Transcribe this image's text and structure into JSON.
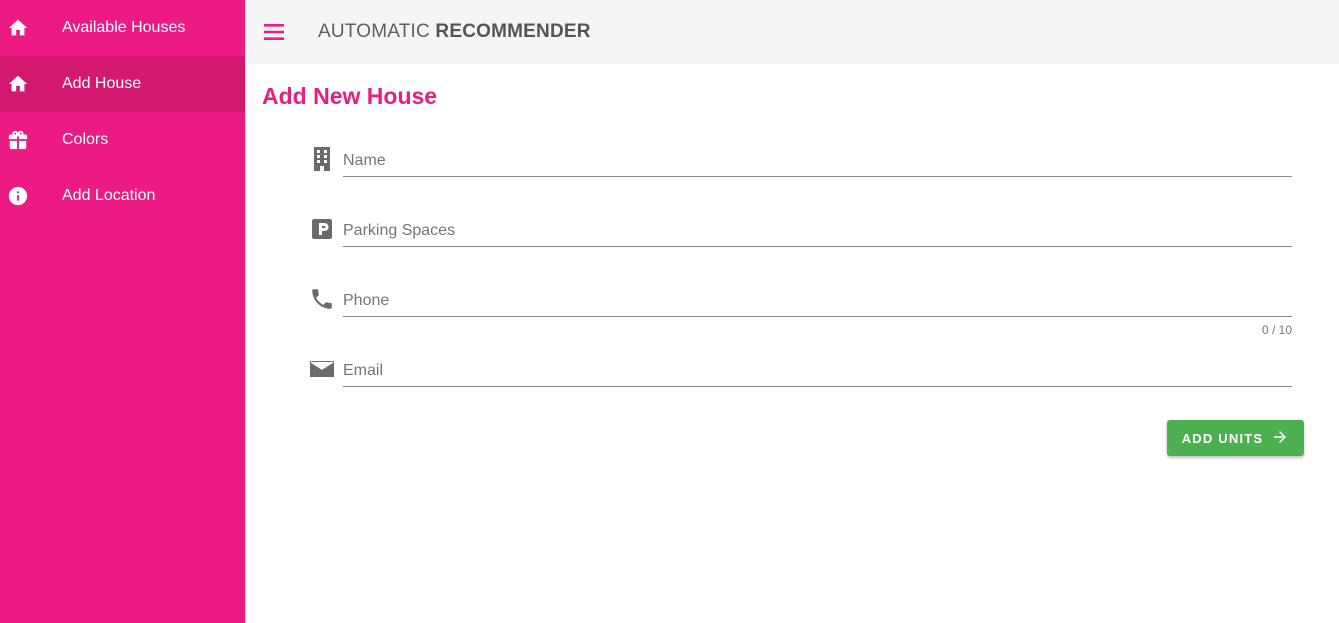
{
  "sidebar": {
    "items": [
      {
        "label": "Available Houses",
        "icon": "home-icon"
      },
      {
        "label": "Add House",
        "icon": "home-icon",
        "active": true
      },
      {
        "label": "Colors",
        "icon": "gift-icon"
      },
      {
        "label": "Add Location",
        "icon": "info-icon"
      }
    ],
    "background": "#ec1a83",
    "active_background": "#d3186f"
  },
  "header": {
    "title_prefix": "AUTOMATIC",
    "title_bold": "RECOMMENDER",
    "menu_icon": "menu-icon"
  },
  "main": {
    "page_title": "Add New House",
    "fields": [
      {
        "placeholder": "Name",
        "icon": "building-icon"
      },
      {
        "placeholder": "Parking Spaces",
        "icon": "parking-icon"
      },
      {
        "placeholder": "Phone",
        "icon": "phone-icon",
        "counter": "0 / 10"
      },
      {
        "placeholder": "Email",
        "icon": "email-icon"
      }
    ],
    "submit_label": "ADD UNITS",
    "submit_icon": "arrow-right-icon"
  },
  "colors": {
    "accent": "#e91e80",
    "button": "#4caf50"
  }
}
